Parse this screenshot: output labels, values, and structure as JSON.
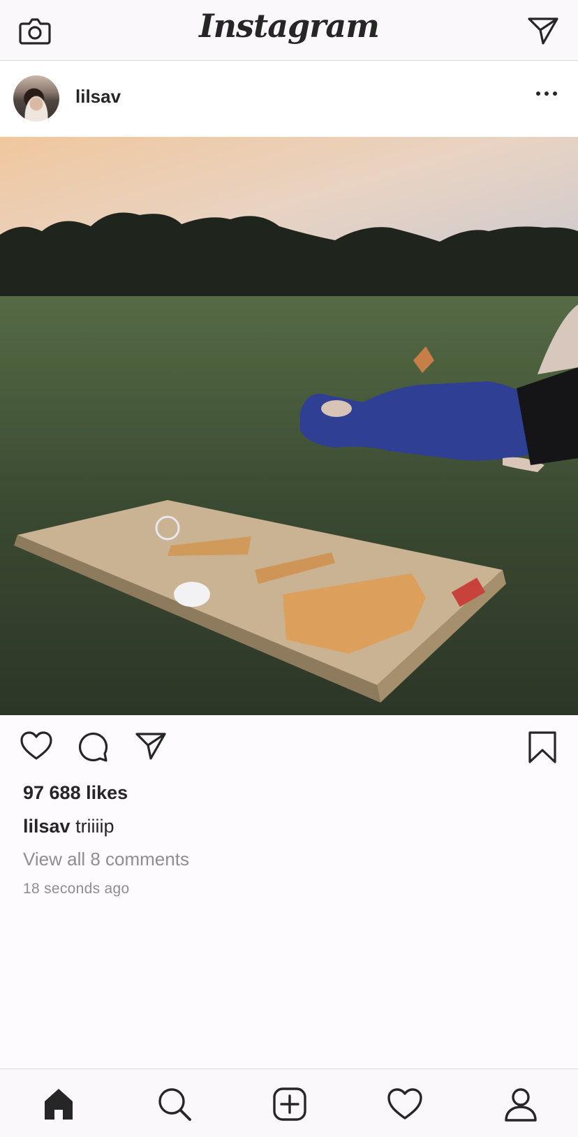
{
  "app": {
    "logo_text": "Instagram"
  },
  "topbar": {
    "camera_icon": "camera-icon",
    "direct_icon": "paper-plane-icon"
  },
  "post": {
    "username": "lilsav",
    "more_icon": "more-options-icon",
    "likes": "97 688 likes",
    "caption_user": "lilsav",
    "caption_text": " triiiip",
    "view_comments": "View all 8 comments",
    "timestamp": "18 seconds ago"
  },
  "actions": {
    "like_icon": "heart-icon",
    "comment_icon": "comment-icon",
    "share_icon": "paper-plane-icon",
    "save_icon": "bookmark-icon"
  },
  "tabbar": {
    "items": [
      "home-icon",
      "search-icon",
      "add-post-icon",
      "activity-heart-icon",
      "profile-icon"
    ]
  },
  "colors": {
    "text": "#262626",
    "secondary_text": "#8e8e8e",
    "border": "#dbdbdb"
  }
}
